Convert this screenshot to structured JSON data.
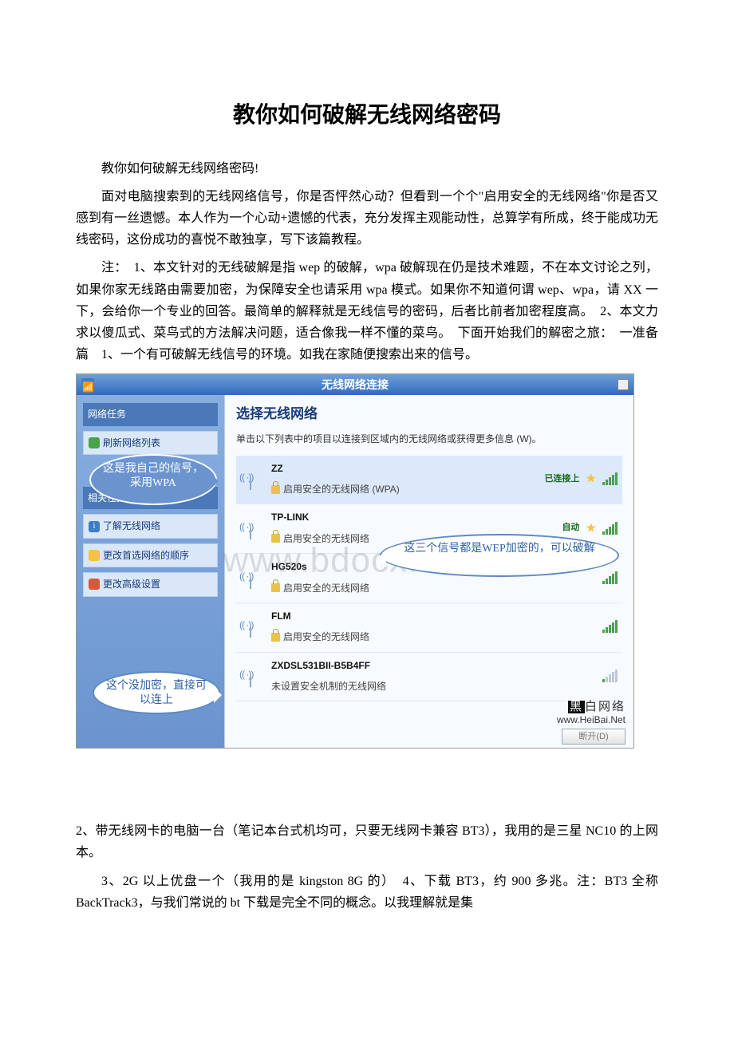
{
  "title": "教你如何破解无线网络密码",
  "para1": "教你如何破解无线网络密码!",
  "para2": "面对电脑搜索到的无线网络信号，你是否怦然心动？但看到一个个\"启用安全的无线网络\"你是否又感到有一丝遗憾。本人作为一个心动+遗憾的代表，充分发挥主观能动性，总算学有所成，终于能成功无线密码，这份成功的喜悦不敢独享，写下该篇教程。",
  "para3": "注：　1、本文针对的无线破解是指 wep 的破解，wpa 破解现在仍是技术难题，不在本文讨论之列，如果你家无线路由需要加密，为保障安全也请采用 wpa 模式。如果你不知道何谓 wep、wpa，请 XX 一下，会给你一个专业的回答。最简单的解释就是无线信号的密码，后者比前者加密程度高。　2、本文力求以傻瓜式、菜鸟式的方法解决问题，适合像我一样不懂的菜鸟。　下面开始我们的解密之旅：　一准备篇　1、一个有可破解无线信号的环境。如我在家随便搜索出来的信号。",
  "para4": " 2、带无线网卡的电脑一台（笔记本台式机均可，只要无线网卡兼容 BT3），我用的是三星 NC10 的上网本。",
  "para5": "3、2G 以上优盘一个（我用的是 kingston 8G 的）　4、下载 BT3，约 900 多兆。注：BT3 全称 BackTrack3，与我们常说的 bt 下载是完全不同的概念。以我理解就是集",
  "fig": {
    "titlebar": "无线网络连接",
    "sidebar": {
      "header": "网络任务",
      "refresh": "刷新网络列表",
      "header2": "相关任务",
      "item_learn": "了解无线网络",
      "item_order": "更改首选网络的顺序",
      "item_adv": "更改高级设置"
    },
    "main": {
      "heading": "选择无线网络",
      "sub": "单击以下列表中的项目以连接到区域内的无线网络或获得更多信息 (W)。",
      "conn_btn": "断开(D)"
    },
    "networks": [
      {
        "ssid": "ZZ",
        "sec": "启用安全的无线网络 (WPA)",
        "status": "已连接上",
        "star": true,
        "lock": true,
        "strong": true
      },
      {
        "ssid": "TP-LINK",
        "sec": "启用安全的无线网络",
        "status": "自动",
        "star": true,
        "lock": true,
        "strong": true
      },
      {
        "ssid": "HG520s",
        "sec": "启用安全的无线网络",
        "status": "",
        "star": false,
        "lock": true,
        "strong": true
      },
      {
        "ssid": "FLM",
        "sec": "启用安全的无线网络",
        "status": "",
        "star": false,
        "lock": true,
        "strong": true
      },
      {
        "ssid": "ZXDSL531BII-B5B4FF",
        "sec": "未设置安全机制的无线网络",
        "status": "",
        "star": false,
        "lock": false,
        "strong": false
      }
    ],
    "bubbles": {
      "b1": "这是我自己的信号，采用WPA",
      "b2": "这三个信号都是WEP加密的，可以破解",
      "b3": "这个没加密，直接可以连上"
    },
    "watermark": "www.bdocx.com",
    "brand_cn": "黑白网络",
    "brand_url": "www.HeiBai.Net"
  }
}
